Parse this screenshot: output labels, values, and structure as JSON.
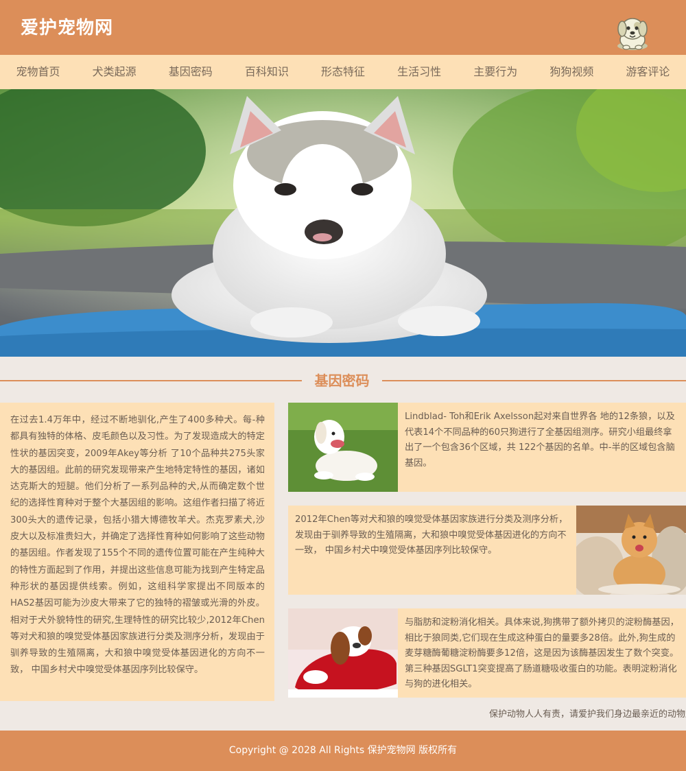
{
  "header": {
    "site_title": "爱护宠物网",
    "logo_icon": "puppy-logo-icon"
  },
  "nav": {
    "items": [
      {
        "label": "宠物首页"
      },
      {
        "label": "犬类起源"
      },
      {
        "label": "基因密码"
      },
      {
        "label": "百科知识"
      },
      {
        "label": "形态特征"
      },
      {
        "label": "生活习性"
      },
      {
        "label": "主要行为"
      },
      {
        "label": "狗狗视频"
      },
      {
        "label": "游客评论"
      }
    ]
  },
  "section": {
    "title": "基因密码"
  },
  "left_card": {
    "text": "在过去1.4万年中，经过不断地驯化,产生了400多种犬。每-种都具有独特的体格、皮毛颜色以及习性。为了发现造成大的特定性状的基因突变，2009年Akey等分析 了10个品种共275头家大的基因组。此前的研究发现带来产生地特定特性的基因，诸如达克斯大的短腿。他们分析了一系列品种的犬,从而确定数个世纪的选择性育种对于整个大基因组的影响。这组作者扫描了将近300头大的遗传记录，包括小猎大博德牧羊犬。杰克罗素犬,沙皮大以及标准贵妇大，并确定了选择性育种如何影响了这些动物的基因组。作者发现了155个不同的遗传位置可能在产生纯种大的特性方面起到了作用，并提出这些信息可能为找到产生特定品种形状的基因提供线索。例如，这组科学家提出不同版本的HAS2基因可能为沙皮大带来了它的独特的褶皱或光滑的外皮。相对于犬外貌特性的研究,生理特性的研究比较少,2012年Chen等对犬和狼的嗅觉受体基因家族进行分类及测序分析，发现由于驯养导致的生殖隔离，大和狼中嗅觉受体基因进化的方向不一致， 中国乡村犬中嗅觉受体基因序列比较保守。"
  },
  "cards": [
    {
      "text": "Lindblad- Toh和Erik Axelsson起对来自世界各 地的12条狼，以及代表14个不同品种的60只狗进行了全基因组测序。研究小组最终拿出了一个包含36个区域，共 122个基因的名单。中-半的区域包含脑基因。"
    },
    {
      "text": "2012年Chen等对犬和狼的嗅觉受体基因家族进行分类及测序分析，发现由于驯养导致的生殖隔离，大和狼中嗅觉受体基因进化的方向不一致， 中国乡村犬中嗅觉受体基因序列比较保守。"
    },
    {
      "text": "与脂肪和淀粉消化相关。具体来说,狗携带了额外拷贝的淀粉酶基因，相比于狼同类,它们现在生成这种蛋白的量要多28倍。此外,狗生成的麦芽糖酶葡糖淀粉酶要多12倍，这是因为该酶基因发生了数个突变。第三种基因SGLT1突变提高了肠道糖吸收蛋白的功能。表明淀粉消化与狗的进化相关。"
    }
  ],
  "marquee": {
    "text": "保护动物人人有责，请爱护我们身边最亲近的动物朋友"
  },
  "footer": {
    "copyright": "Copyright @ 2028 All Rights 保护宠物网 版权所有"
  },
  "colors": {
    "header": "#dc8e59",
    "nav": "#fde0b6",
    "card": "#fde0b6",
    "background": "#efe9e4"
  }
}
